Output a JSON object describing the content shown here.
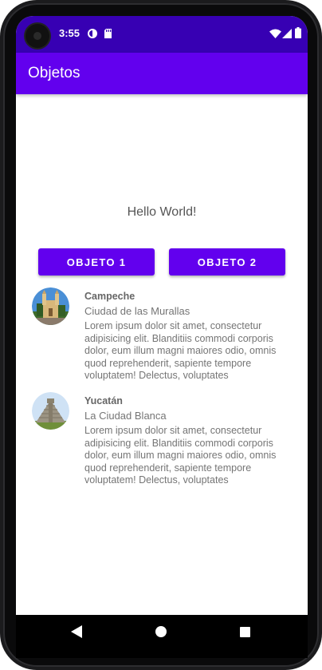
{
  "status_bar": {
    "time": "3:55",
    "background_color": "#3700b3",
    "left_icons": [
      "circle-notification-icon",
      "sd-card-icon"
    ],
    "right_icons": [
      "wifi-icon",
      "signal-icon",
      "battery-icon"
    ]
  },
  "app_bar": {
    "title": "Objetos",
    "color": "#6200ee"
  },
  "main": {
    "hello_text": "Hello World!",
    "buttons": [
      {
        "label": "OBJETO 1"
      },
      {
        "label": "OBJETO 2"
      }
    ],
    "items": [
      {
        "title": "Campeche",
        "subtitle": "Ciudad de las Murallas",
        "description": "Lorem ipsum dolor sit amet, consectetur adipisicing elit. Blanditiis commodi corporis dolor, eum illum magni maiores odio, omnis quod reprehenderit, sapiente tempore voluptatem! Delectus, voluptates",
        "image": "cathedral-image"
      },
      {
        "title": "Yucatán",
        "subtitle": "La Ciudad Blanca",
        "description": "Lorem ipsum dolor sit amet, consectetur adipisicing elit. Blanditiis commodi corporis dolor, eum illum magni maiores odio, omnis quod reprehenderit, sapiente tempore voluptatem! Delectus, voluptates",
        "image": "pyramid-image"
      }
    ]
  },
  "nav_bar": {
    "icons": [
      "back-icon",
      "home-icon",
      "recents-icon"
    ]
  }
}
